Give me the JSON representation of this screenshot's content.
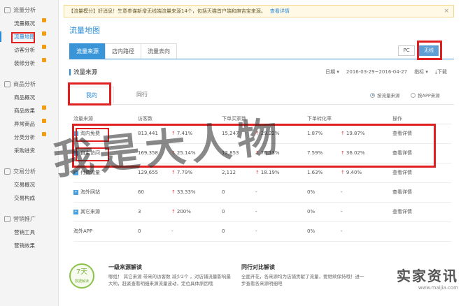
{
  "sidebar": {
    "sections": [
      {
        "title": "流量分析",
        "items": [
          {
            "label": "流量概况",
            "new": true,
            "active": false
          },
          {
            "label": "流量地图",
            "new": true,
            "active": true
          },
          {
            "label": "访客分析",
            "new": true,
            "active": false
          },
          {
            "label": "装修分析",
            "new": true,
            "active": false
          }
        ]
      },
      {
        "title": "商品分析",
        "items": [
          {
            "label": "商品概况",
            "new": false
          },
          {
            "label": "商品效果",
            "new": true
          },
          {
            "label": "异常商品",
            "new": true
          },
          {
            "label": "分类分析",
            "new": true
          },
          {
            "label": "采购进货",
            "new": false
          }
        ]
      },
      {
        "title": "交易分析",
        "items": [
          {
            "label": "交易概况",
            "new": false
          },
          {
            "label": "交易构成",
            "new": false
          }
        ]
      },
      {
        "title": "营销推广",
        "items": [
          {
            "label": "营销工具",
            "new": false
          },
          {
            "label": "营销效果",
            "new": false
          }
        ]
      }
    ]
  },
  "notice": {
    "text": "【流量模分】好消息！生意参谋新增无线端流量来源14个，包括天猫首户端和麻吉宝来源。",
    "link": "查看详情",
    "close": "×"
  },
  "page_title": "流量地图",
  "tabs": [
    "流量来源",
    "店内路径",
    "流量去向"
  ],
  "device": {
    "pc": "PC",
    "wireless": "无线"
  },
  "section": {
    "title": "流量来源",
    "date_label": "日期",
    "date_range": "2016-03-29~2016-04-27",
    "metric_label": "指标",
    "download": "下载"
  },
  "subtabs": {
    "mine": "我的",
    "peer": "同行"
  },
  "radios": {
    "by_source": "按流量来源",
    "by_app": "按APP来源"
  },
  "table": {
    "headers": [
      "流量来源",
      "访客数",
      "",
      "下单买家数",
      "",
      "下单转化率",
      "",
      "操作"
    ],
    "rows": [
      {
        "name": "淘内免费",
        "visitors": "813,441",
        "v_chg": "7.41%",
        "buyers": "15,247",
        "b_chg": "29.22%",
        "rate": "1.87%",
        "r_chg": "19.87%",
        "op": "查看详情"
      },
      {
        "name": "自主访问",
        "visitors": "169,358",
        "v_chg": "25.14%",
        "buyers": "12,853",
        "b_chg": "70.13%",
        "rate": "7.59%",
        "r_chg": "36.02%",
        "op": "查看详情"
      },
      {
        "name": "付费流量",
        "visitors": "129,655",
        "v_chg": "7.79%",
        "buyers": "2,112",
        "b_chg": "18.19%",
        "rate": "1.63%",
        "r_chg": "9.40%",
        "op": "查看详情"
      },
      {
        "name": "淘外网站",
        "visitors": "60",
        "v_chg": "33.33%",
        "buyers": "0",
        "b_chg": "-",
        "rate": "0%",
        "r_chg": "-",
        "op": "查看详情"
      },
      {
        "name": "其它来源",
        "visitors": "3",
        "v_chg": "200%",
        "buyers": "0",
        "b_chg": "-",
        "rate": "0%",
        "r_chg": "-",
        "op": "查看详情"
      },
      {
        "name": "淘外APP",
        "visitors": "0",
        "v_chg": "-",
        "buyers": "0",
        "b_chg": "-",
        "rate": "0%",
        "r_chg": "-",
        "op": ""
      }
    ]
  },
  "bottom": {
    "badge_number": "7天",
    "badge_text": "数据解读",
    "left_title": "一级来源解读",
    "left_text": "哪组！ 其它来源 带来的访客数 减少2个 ，对店铺流量影响最大哟，赶紧查看明细来源流量波动，定位具体原因哦",
    "right_title": "同行对比解读",
    "right_text": "全面开花，各来源均为店铺贡献了流量，要继续保持哦！进一步查看各来源明细吧"
  },
  "watermark": {
    "text": "我是大人物",
    "brand": "实家资讯",
    "url": "www.maijia.com"
  }
}
